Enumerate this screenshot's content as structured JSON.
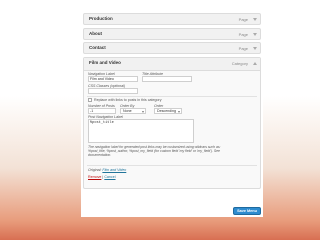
{
  "menu_items": [
    {
      "title": "Production",
      "type": "Page"
    },
    {
      "title": "About",
      "type": "Page"
    },
    {
      "title": "Contact",
      "type": "Page"
    }
  ],
  "expanded_item": {
    "title": "Film and Video",
    "type": "Category",
    "navigation_label_label": "Navigation Label",
    "navigation_label_value": "Film and Video",
    "title_attribute_label": "Title Attribute",
    "title_attribute_value": "",
    "css_classes_label": "CSS Classes (optional)",
    "css_classes_value": "",
    "replace_checkbox_label": "Replace with links to posts in this category",
    "number_of_posts_label": "Number of Posts",
    "number_of_posts_value": "-1",
    "order_by_label": "Order By",
    "order_by_value": "None",
    "order_label": "Order",
    "order_value": "Descending",
    "post_nav_label_label": "Post Navigation Label",
    "post_nav_label_value": "%post_title",
    "help_text": "The navigation label for generated post links may be customized using wildcars such as: %post_title, %post_author, %post_my_field (for custom field 'my field' or 'my_field'). See documentation.",
    "original_label": "Original:",
    "original_link": "Film and Video",
    "remove_label": "Remove",
    "separator": "|",
    "cancel_label": "Cancel"
  },
  "save_button_label": "Save Menu",
  "colors": {
    "accent": "#2e8ccf",
    "link": "#21759b",
    "remove": "#bc0b0b"
  }
}
